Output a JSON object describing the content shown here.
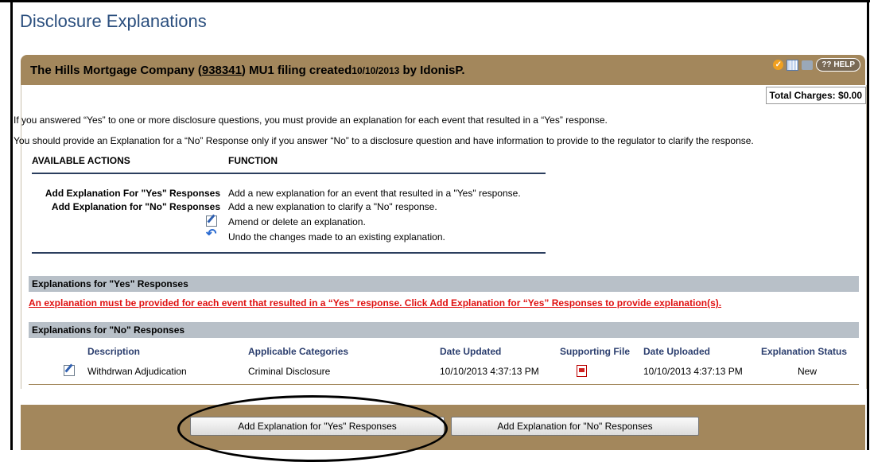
{
  "page": {
    "title": "Disclosure Explanations"
  },
  "banner": {
    "company": "The Hills Mortgage Company (",
    "company_id": "938341",
    "filing": ") MU1 filing created",
    "date": "10/10/2013",
    "by": " by IdonisP.",
    "help_label": "?? HELP"
  },
  "charges": "Total Charges: $0.00",
  "info": {
    "line1": "If you answered “Yes” to one or more disclosure questions, you must provide an explanation for each event that resulted in a “Yes” response.",
    "line2": "You should provide an Explanation for a “No” Response only if you answer “No” to a disclosure question and have information to provide to the regulator to clarify the response."
  },
  "actions": {
    "col1": "AVAILABLE ACTIONS",
    "col2": "FUNCTION",
    "rows": [
      {
        "label": "Add Explanation For \"Yes\" Responses",
        "function": "Add a new explanation for an event that resulted in a \"Yes\" response."
      },
      {
        "label": "Add Explanation for \"No\" Responses",
        "function": "Add a new explanation to clarify a \"No\" response."
      },
      {
        "icon": "edit-icon",
        "function": "Amend or delete an explanation."
      },
      {
        "icon": "undo-icon",
        "function": "Undo the changes made to an existing explanation."
      }
    ]
  },
  "yes_section": {
    "title": "Explanations for \"Yes\" Responses",
    "warning": "An explanation must be provided for each event that resulted in a “Yes” response. Click Add Explanation for “Yes” Responses to provide explanation(s)."
  },
  "no_section": {
    "title": "Explanations for \"No\" Responses",
    "columns": [
      "Description",
      "Applicable Categories",
      "Date Updated",
      "Supporting File",
      "Date Uploaded",
      "Explanation Status"
    ],
    "rows": [
      {
        "description": "Withdrwan Adjudication",
        "categories": "Criminal Disclosure",
        "date_updated": "10/10/2013 4:37:13 PM",
        "file_icon": "pdf-icon",
        "date_uploaded": "10/10/2013 4:37:13 PM",
        "status": "New"
      }
    ]
  },
  "buttons": {
    "add_yes": "Add Explanation for \"Yes\" Responses",
    "add_no": "Add Explanation for \"No\" Responses"
  },
  "colors": {
    "banner": "#a3875c",
    "title": "#2b4f7e",
    "warning": "#e01010",
    "section_bar": "#b8c0c8"
  }
}
